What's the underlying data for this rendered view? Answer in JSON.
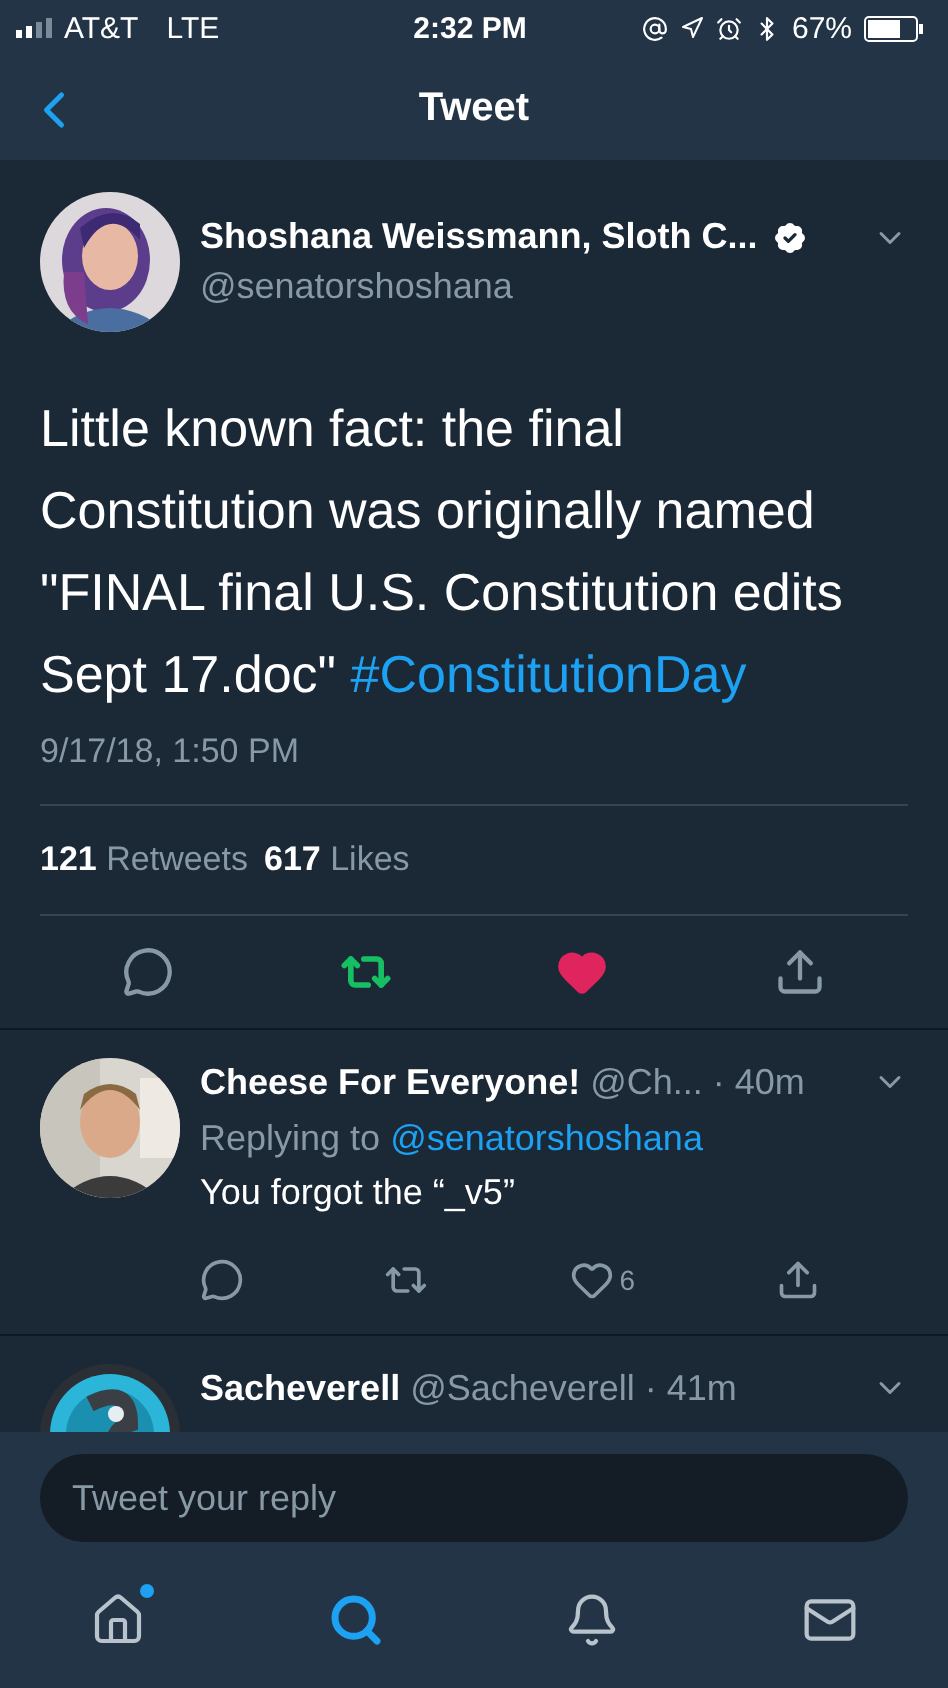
{
  "status_bar": {
    "carrier": "AT&T",
    "network": "LTE",
    "time": "2:32 PM",
    "battery": "67%"
  },
  "nav": {
    "title": "Tweet"
  },
  "tweet": {
    "name": "Shoshana Weissmann, Sloth C...",
    "verified": true,
    "handle": "@senatorshoshana",
    "text": "Little known fact: the final Constitution was originally named \"FINAL final U.S. Constitution edits Sept 17.doc\"",
    "hashtag": "#ConstitutionDay",
    "date": "9/17/18, 1:50 PM",
    "retweet_count": "121",
    "retweet_label": "Retweets",
    "like_count": "617",
    "like_label": "Likes",
    "retweeted": true,
    "liked": true
  },
  "replies": [
    {
      "name": "Cheese For Everyone!",
      "handle": "@Ch...",
      "time": "· 40m",
      "replying_label": "Replying to",
      "replying_to": "@senatorshoshana",
      "text": "You forgot the “_v5”",
      "like_count": "6",
      "retweeted": false,
      "liked": false
    },
    {
      "name": "Sacheverell",
      "handle": "@Sacheverell",
      "time": "· 41m",
      "kind": "logo"
    }
  ],
  "composer": {
    "placeholder": "Tweet your reply"
  },
  "tab_bar": [
    {
      "kind": "home",
      "selected": false,
      "dot": true
    },
    {
      "kind": "search",
      "selected": true,
      "dot": false
    },
    {
      "kind": "notifications",
      "selected": false,
      "dot": false
    },
    {
      "kind": "messages",
      "selected": false,
      "dot": false
    }
  ]
}
